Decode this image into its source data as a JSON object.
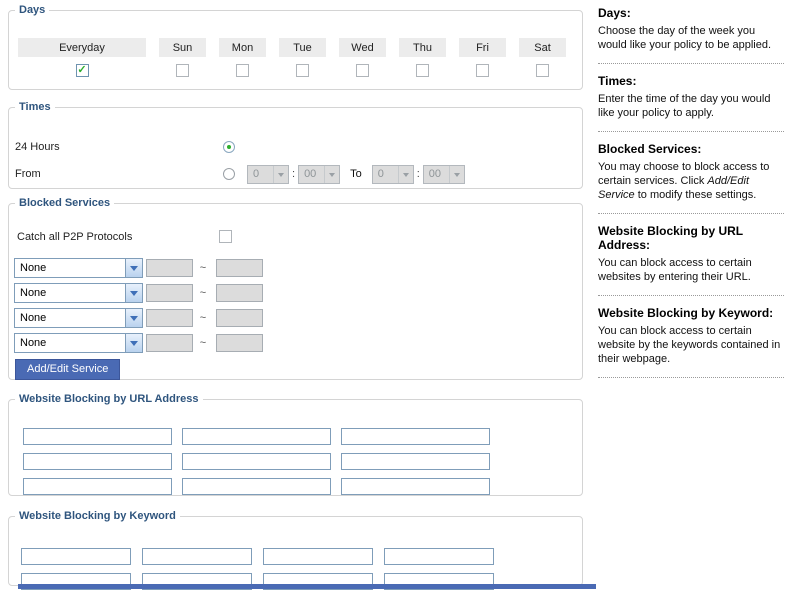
{
  "colors": {
    "legend_text": "#2f557e",
    "header_cell_bg": "#ececec",
    "select_border": "#7f9db9",
    "disabled_bg": "#dcdcdc",
    "check_green": "#2faf2f",
    "button_bg": "#4a6ab4",
    "bottom_strip": "#4a6ab4"
  },
  "days": {
    "legend": "Days",
    "columns": [
      {
        "label": "Everyday",
        "checked": true
      },
      {
        "label": "Sun",
        "checked": false
      },
      {
        "label": "Mon",
        "checked": false
      },
      {
        "label": "Tue",
        "checked": false
      },
      {
        "label": "Wed",
        "checked": false
      },
      {
        "label": "Thu",
        "checked": false
      },
      {
        "label": "Fri",
        "checked": false
      },
      {
        "label": "Sat",
        "checked": false
      }
    ]
  },
  "times": {
    "legend": "Times",
    "hours24_label": "24 Hours",
    "from_label": "From",
    "to_label": "To",
    "colon": ":",
    "from_hour": "0",
    "from_minute": "00",
    "to_hour": "0",
    "to_minute": "00",
    "selected_option": "24 Hours"
  },
  "blocked_services": {
    "legend": "Blocked Services",
    "catch_all_label": "Catch all P2P Protocols",
    "catch_all_checked": false,
    "tilde": "~",
    "rows": [
      {
        "value": "None"
      },
      {
        "value": "None"
      },
      {
        "value": "None"
      },
      {
        "value": "None"
      }
    ],
    "button_label": "Add/Edit Service"
  },
  "url_blocking": {
    "legend": "Website Blocking by URL Address",
    "values": [
      "",
      "",
      "",
      "",
      "",
      "",
      "",
      "",
      ""
    ]
  },
  "keyword_blocking": {
    "legend": "Website Blocking by Keyword",
    "values": [
      "",
      "",
      "",
      "",
      "",
      "",
      "",
      ""
    ]
  },
  "help": {
    "sections": [
      {
        "title": "Days:",
        "text": "Choose the day of the week you would like your policy to be applied."
      },
      {
        "title": "Times:",
        "text": "Enter the time of the day you would like your policy to apply."
      },
      {
        "title": "Blocked Services:",
        "text_before": "You may choose to block access to certain services. Click ",
        "italic_text": "Add/Edit Service",
        "text_after": " to modify these settings."
      },
      {
        "title": "Website Blocking by URL Address:",
        "text": "You can block access to certain websites by entering their URL."
      },
      {
        "title": "Website Blocking by Keyword:",
        "text": "You can block access to certain website by the keywords contained in their webpage."
      }
    ]
  }
}
